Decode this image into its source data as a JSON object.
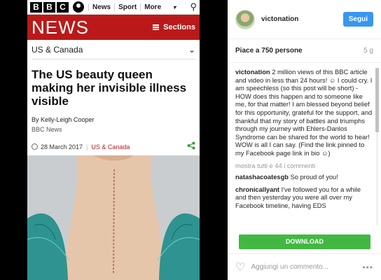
{
  "bbc": {
    "logo_letters": [
      "B",
      "B",
      "C"
    ],
    "nav": [
      "News",
      "Sport",
      "More"
    ],
    "more_chevron": "▾",
    "search_icon": "⚲",
    "news_wordmark": "NEWS",
    "sections_label": "Sections",
    "region": "US & Canada",
    "region_chevron": "⌄",
    "headline": "The US beauty queen making her invisible illness visible",
    "byline": "By Kelly-Leigh Cooper",
    "source": "BBC News",
    "date": "28 March 2017",
    "date_separator": "|",
    "date_tag": "US & Canada",
    "share_icon": "share-icon",
    "accent": "#bb1919"
  },
  "post": {
    "username": "victonation",
    "follow_label": "Segui",
    "likes": "Piace a 750 persone",
    "age": "5 g",
    "caption_user": "victonation",
    "caption_text": "2 million views of this BBC article and video in less than 24 hours! ☺ I could cry. I am speechless (so this post will be short) - HOW does this happen and to someone like me, for that matter! I am blessed beyond belief for this opportunity, grateful for the support, and thankful that my story of battles and triumphs through my journey with Ehlers-Danlos Syndrome can be shared for the world to hear! WOW is all I can say. (Find the link pinned to my Facebook page link in bio ☺)",
    "show_all": "mostra tutti e 44 i commenti",
    "comments": [
      {
        "user": "natashacoatesgb",
        "text": "So proud of you!"
      },
      {
        "user": "chronicallyant",
        "text": "I've followed you for a while and then yesterday you were all over my Facebook timeline, having EDS"
      }
    ],
    "download_label": "DOWNLOAD",
    "add_comment_placeholder": "Aggiungi un commento...",
    "more_options": "•••",
    "follow_color": "#3897f0",
    "download_color": "#42b843"
  }
}
